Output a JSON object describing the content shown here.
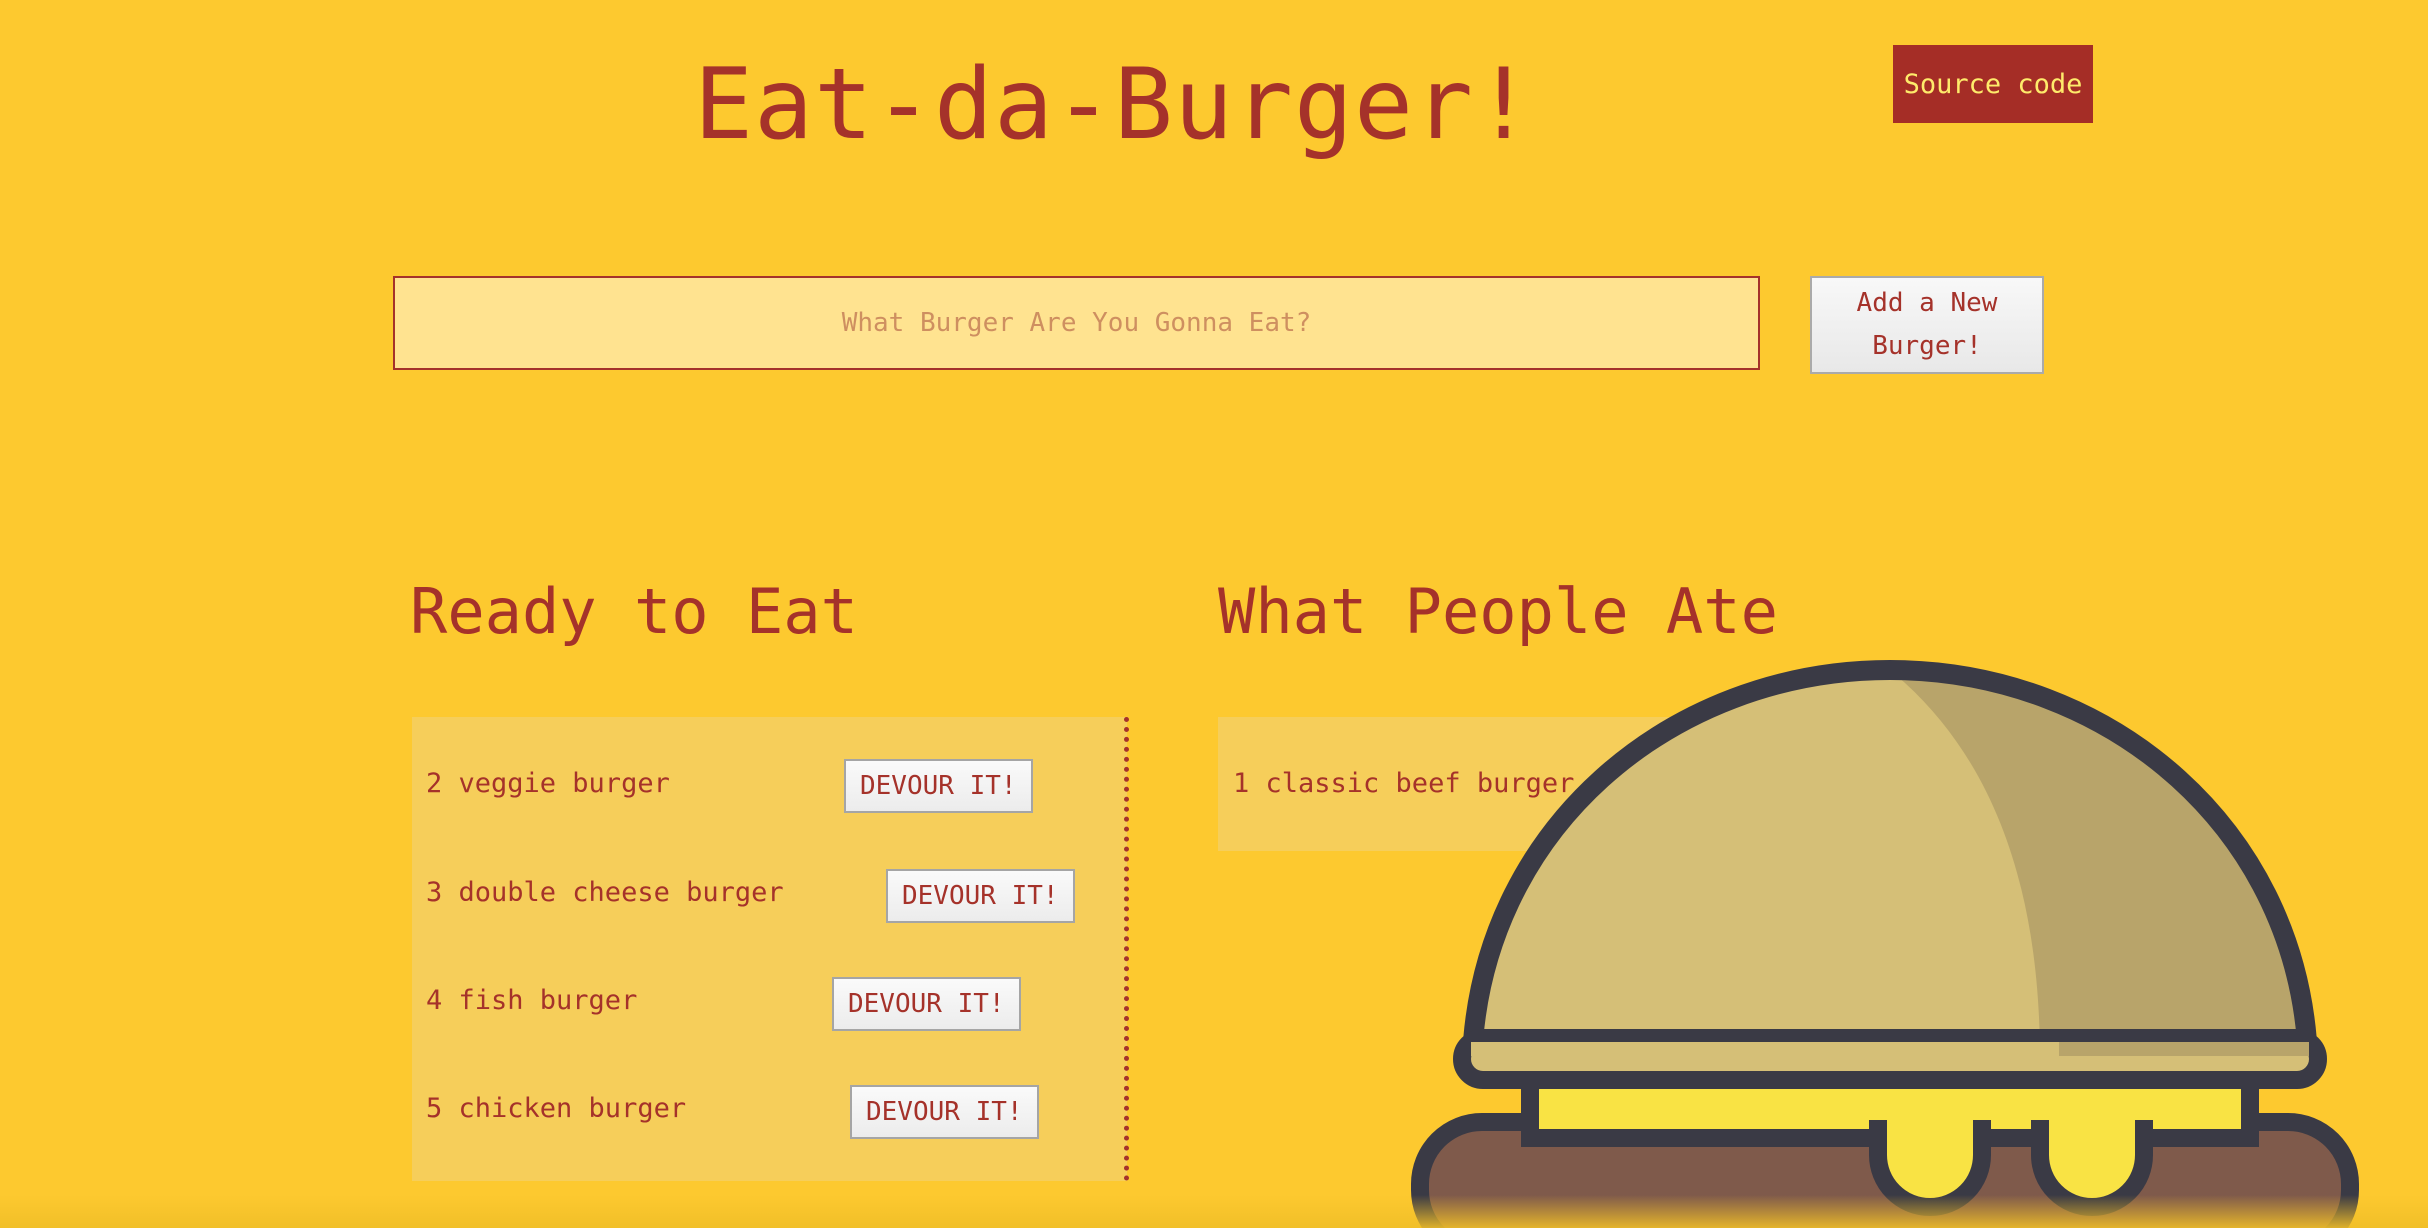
{
  "header": {
    "title": "Eat-da-Burger!",
    "source_label": "Source code"
  },
  "form": {
    "placeholder": "What Burger Are You Gonna Eat?",
    "value": "",
    "add_label": "Add a New Burger!"
  },
  "ready": {
    "heading": "Ready to Eat",
    "items": [
      {
        "label": "2 veggie burger",
        "button": "DEVOUR IT!"
      },
      {
        "label": "3 double cheese burger",
        "button": "DEVOUR IT!"
      },
      {
        "label": "4 fish burger",
        "button": "DEVOUR IT!"
      },
      {
        "label": "5 chicken burger",
        "button": "DEVOUR IT!"
      }
    ]
  },
  "eaten": {
    "heading": "What People Ate",
    "items": [
      {
        "label": "1 classic beef burger"
      }
    ]
  },
  "colors": {
    "background": "#FDC92F",
    "text": "#A5322A",
    "source_button_bg": "#A52D26",
    "source_button_text": "#FEEB6B",
    "input_bg": "#FFE390",
    "panel_bg": "#F6CE5A"
  },
  "icons": {
    "burger_illustration": "burger-icon"
  }
}
